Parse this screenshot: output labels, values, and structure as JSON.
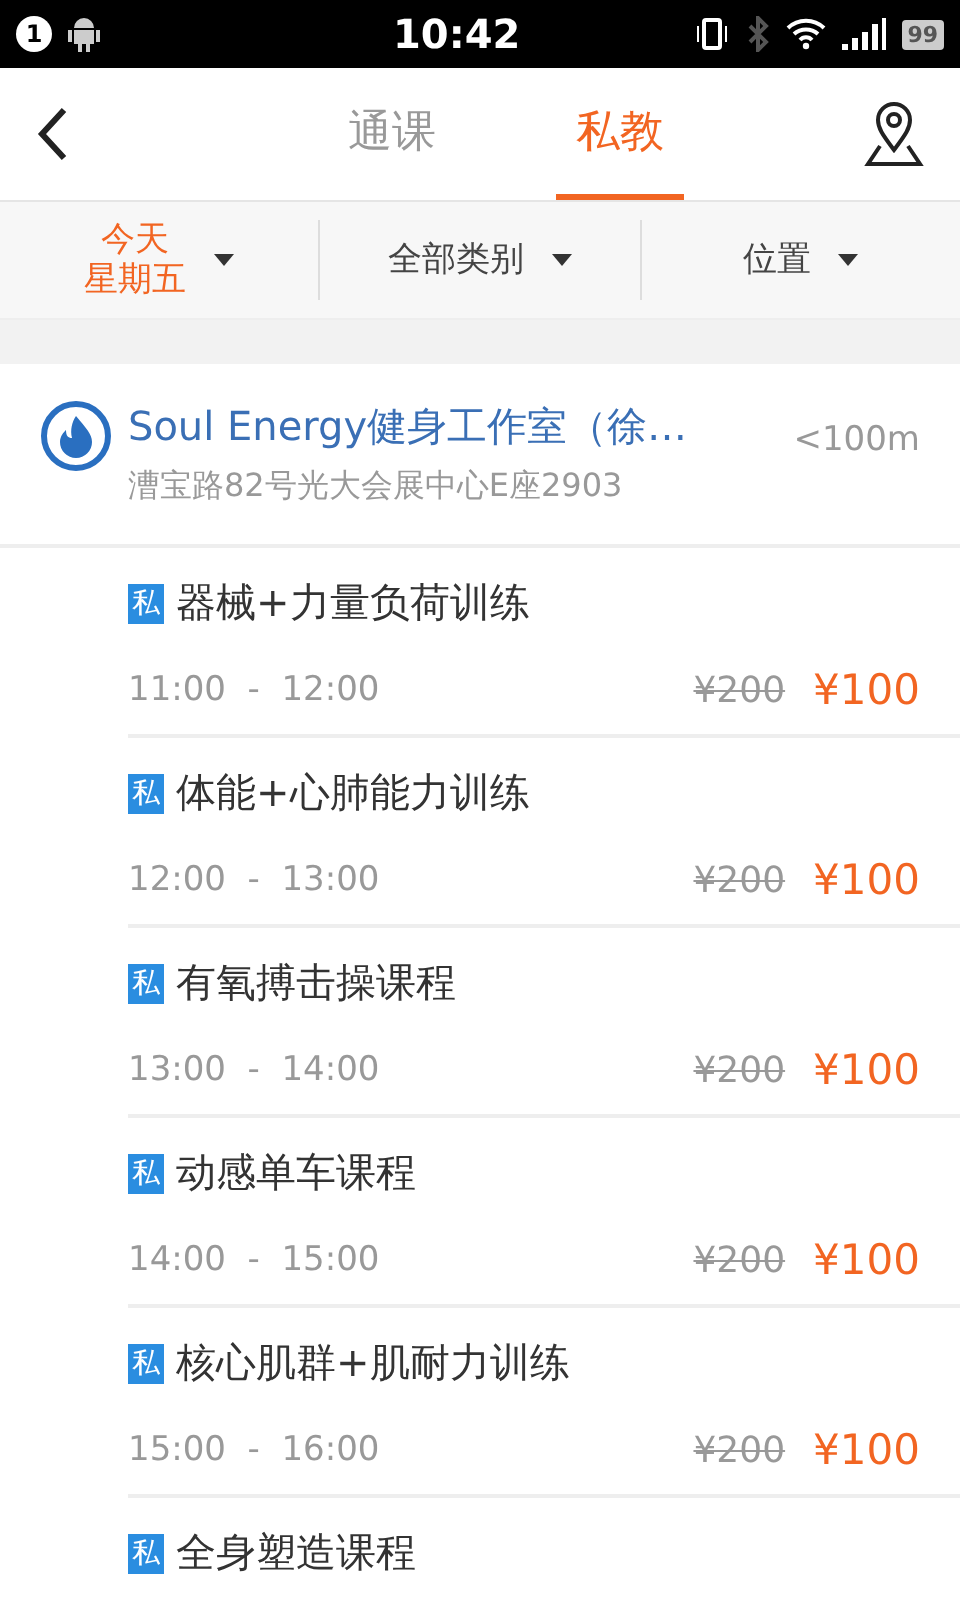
{
  "status_bar": {
    "notification_count": "1",
    "time": "10:42",
    "battery": "99"
  },
  "header": {
    "tabs": [
      {
        "label": "通课",
        "selected": false
      },
      {
        "label": "私教",
        "selected": true
      }
    ]
  },
  "filters": [
    {
      "label": "今天",
      "sublabel": "星期五",
      "selected": true
    },
    {
      "label": "全部类别",
      "selected": false
    },
    {
      "label": "位置",
      "selected": false
    }
  ],
  "venue": {
    "name": "Soul Energy健身工作室（徐…",
    "address": "漕宝路82号光大会展中心E座2903",
    "distance": "<100m"
  },
  "classes": [
    {
      "badge": "私",
      "title": "器械+力量负荷训练",
      "time": "11:00  -  12:00",
      "original_price": "¥200",
      "price": "¥100"
    },
    {
      "badge": "私",
      "title": "体能+心肺能力训练",
      "time": "12:00  -  13:00",
      "original_price": "¥200",
      "price": "¥100"
    },
    {
      "badge": "私",
      "title": "有氧搏击操课程",
      "time": "13:00  -  14:00",
      "original_price": "¥200",
      "price": "¥100"
    },
    {
      "badge": "私",
      "title": "动感单车课程",
      "time": "14:00  -  15:00",
      "original_price": "¥200",
      "price": "¥100"
    },
    {
      "badge": "私",
      "title": "核心肌群+肌耐力训练",
      "time": "15:00  -  16:00",
      "original_price": "¥200",
      "price": "¥100"
    },
    {
      "badge": "私",
      "title": "全身塑造课程"
    }
  ]
}
